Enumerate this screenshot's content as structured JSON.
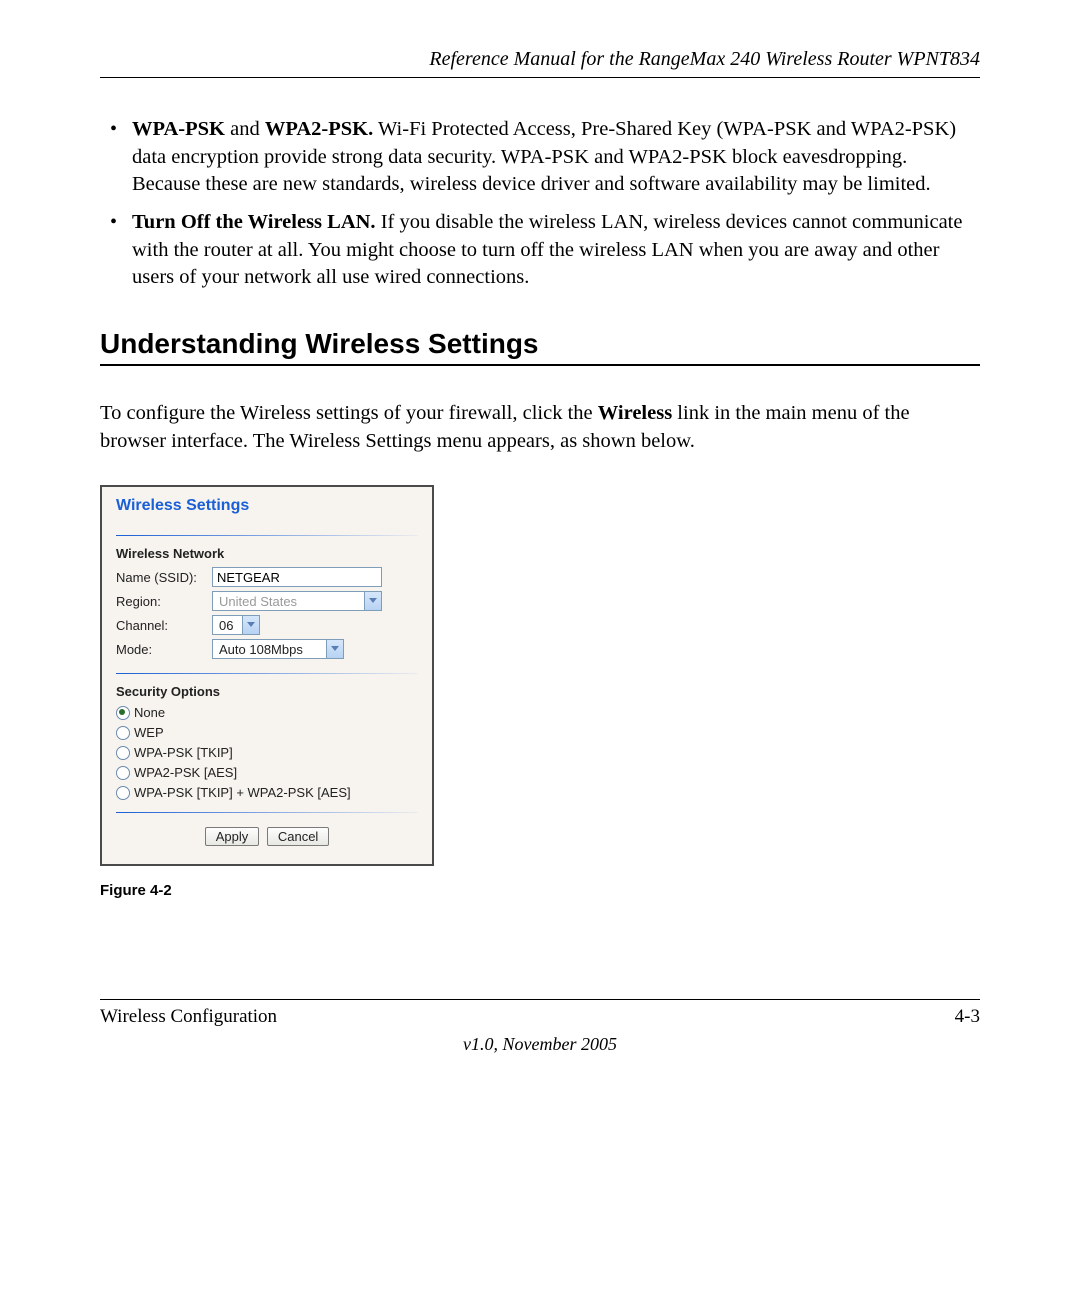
{
  "header": {
    "title": "Reference Manual for the RangeMax 240 Wireless Router WPNT834"
  },
  "bullets": [
    {
      "bold": "WPA-PSK",
      "mid": " and ",
      "bold2": "WPA2-PSK.",
      "text": " Wi-Fi Protected Access, Pre-Shared Key (WPA-PSK and WPA2-PSK) data encryption provide strong data security. WPA-PSK and WPA2-PSK block eavesdropping. Because these are new standards, wireless device driver and software availability may be limited."
    },
    {
      "bold": "Turn Off the Wireless LAN.",
      "text": " If you disable the wireless LAN, wireless devices cannot communicate with the router at all. You might choose to turn off the wireless LAN when you are away and other users of your network all use wired connections."
    }
  ],
  "section_heading": "Understanding Wireless Settings",
  "intro": {
    "pre": "To configure the Wireless settings of your firewall, click the ",
    "bold": "Wireless",
    "post": " link in the main menu of the browser interface. The Wireless Settings menu appears, as shown below."
  },
  "panel": {
    "title": "Wireless Settings",
    "network_header": "Wireless Network",
    "fields": {
      "name_label": "Name (SSID):",
      "name_value": "NETGEAR",
      "region_label": "Region:",
      "region_value": "United States",
      "channel_label": "Channel:",
      "channel_value": "06",
      "mode_label": "Mode:",
      "mode_value": "Auto 108Mbps"
    },
    "security_header": "Security Options",
    "security_options": [
      {
        "label": "None",
        "checked": true
      },
      {
        "label": "WEP",
        "checked": false
      },
      {
        "label": "WPA-PSK [TKIP]",
        "checked": false
      },
      {
        "label": "WPA2-PSK [AES]",
        "checked": false
      },
      {
        "label": "WPA-PSK [TKIP] + WPA2-PSK [AES]",
        "checked": false
      }
    ],
    "buttons": {
      "apply": "Apply",
      "cancel": "Cancel"
    }
  },
  "figure_caption": "Figure 4-2",
  "footer": {
    "left": "Wireless Configuration",
    "right": "4-3",
    "version": "v1.0, November 2005"
  }
}
